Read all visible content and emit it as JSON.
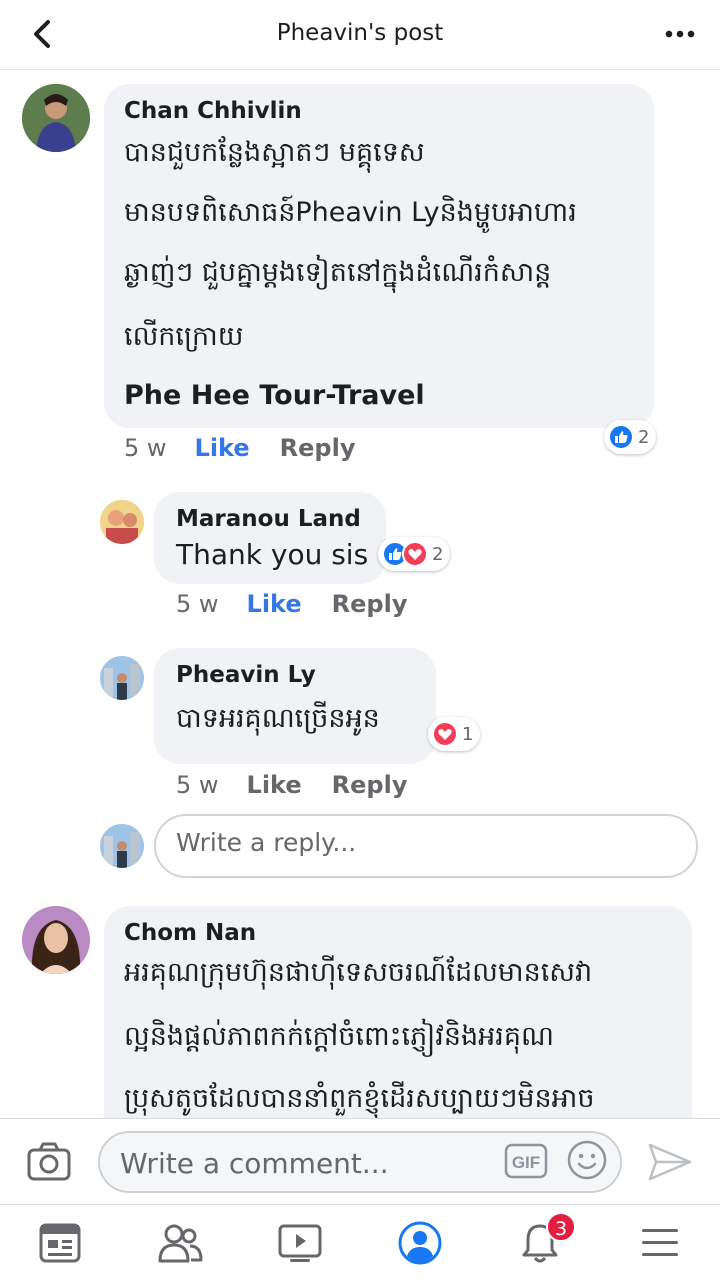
{
  "header": {
    "title": "Pheavin's post"
  },
  "comments": [
    {
      "author": "Chan Chhivlin",
      "lines": [
        "បានជួបកន្លែងស្អាតៗ មគ្គុទេស",
        "មានបទពិសោធន៍Pheavin Lyនិងម្ហូបអាហារ",
        "ឆ្ងាញ់ៗ ជួបគ្នាម្តងទៀតនៅក្នុងដំណើរកំសាន្ត",
        "លើកក្រោយ",
        "Phe Hee Tour-Travel"
      ],
      "time": "5 w",
      "like": "Like",
      "reply": "Reply",
      "reaction_count": "2"
    },
    {
      "author": "Maranou Land",
      "text": "Thank you sis",
      "time": "5 w",
      "like": "Like",
      "reply": "Reply",
      "reaction_count": "2"
    },
    {
      "author": "Pheavin Ly",
      "text": "បាទអរគុណច្រើនអូន",
      "time": "5 w",
      "like": "Like",
      "reply": "Reply",
      "reaction_count": "1"
    },
    {
      "author": "Chom Nan",
      "lines": [
        "អរគុណក្រុមហ៊ុនផាហ៊ីទេសចរណ៍ដែលមានសេវា",
        "ល្អនិងផ្តល់ភាពកក់ក្តៅចំពោះភ្ញៀវនិងអរគុណ",
        "ប្រុសតូចដែលបាននាំពួកខ្ញុំដើរសប្បាយៗមិនអាច"
      ]
    }
  ],
  "reply_box": {
    "placeholder": "Write a reply..."
  },
  "composer": {
    "placeholder": "Write a comment...",
    "gif_label": "GIF"
  },
  "tabbar": {
    "notifications_badge": "3"
  },
  "colors": {
    "accent": "#3578e5",
    "like_blue": "#1877f2",
    "love_red": "#f33e58",
    "bubble_gray": "#f0f2f5",
    "badge_red": "#e41e3f"
  }
}
